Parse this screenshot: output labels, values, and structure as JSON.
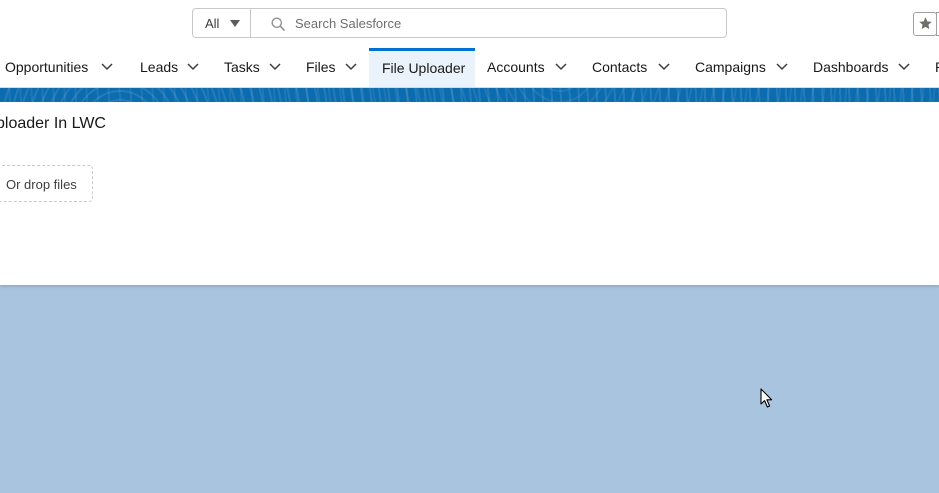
{
  "search": {
    "scope_label": "All",
    "placeholder": "Search Salesforce",
    "value": ""
  },
  "nav": {
    "items": [
      {
        "label": "Opportunities",
        "has_menu": true
      },
      {
        "label": "Leads",
        "has_menu": true
      },
      {
        "label": "Tasks",
        "has_menu": true
      },
      {
        "label": "Files",
        "has_menu": true
      },
      {
        "label": "File Uploader",
        "has_menu": false,
        "active": true
      },
      {
        "label": "Accounts",
        "has_menu": true
      },
      {
        "label": "Contacts",
        "has_menu": true
      },
      {
        "label": "Campaigns",
        "has_menu": true
      },
      {
        "label": "Dashboards",
        "has_menu": true
      },
      {
        "label": "R",
        "has_menu": false
      }
    ]
  },
  "card": {
    "title": "ploader In LWC",
    "drop_label": "Or drop files"
  },
  "icons": {
    "favorites": "star-icon",
    "search": "search-icon",
    "scope": "caret-down-icon",
    "menu": "chevron-down-icon"
  },
  "colors": {
    "accent": "#0070d2",
    "brand_band": "#0b6cb0",
    "page_background": "#a8c4df",
    "active_tab_bg": "#eaf2fb"
  }
}
